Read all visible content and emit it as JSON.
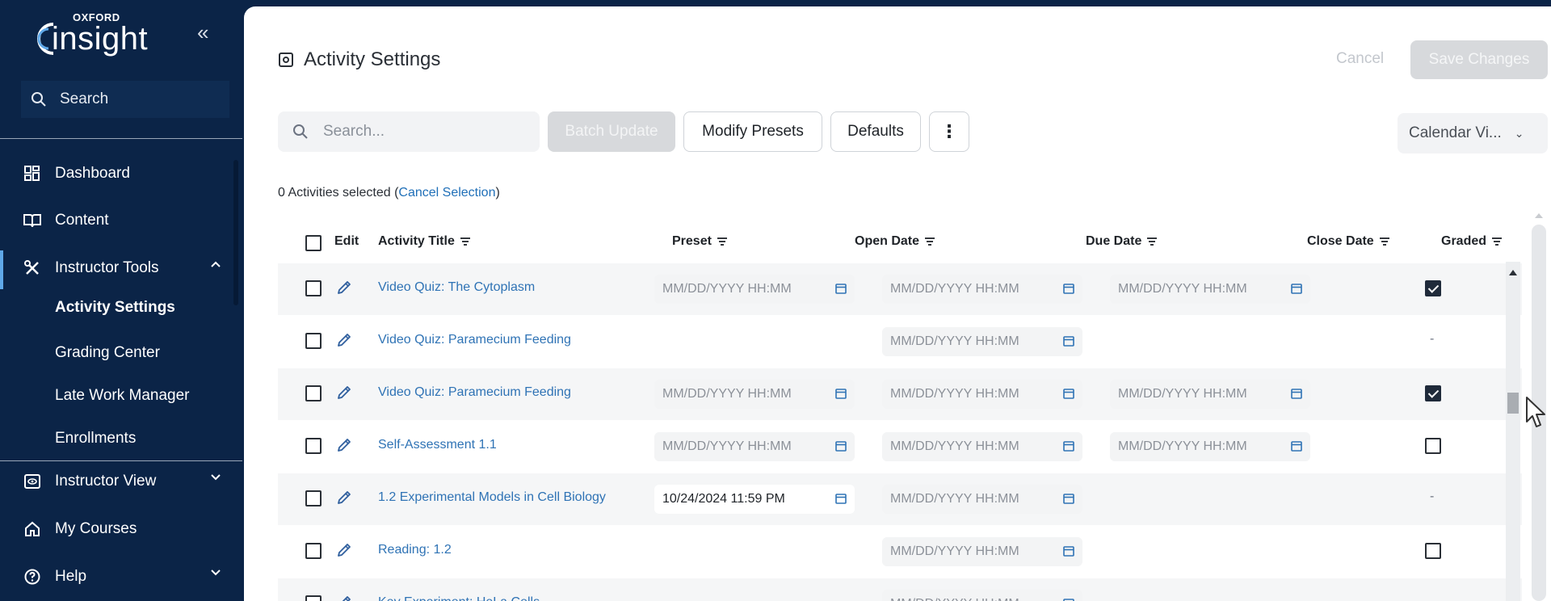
{
  "brand": {
    "top": "OXFORD",
    "name": "insight"
  },
  "sidebar": {
    "search_label": "Search",
    "items": [
      {
        "label": "Dashboard",
        "icon": "dashboard-icon"
      },
      {
        "label": "Content",
        "icon": "book-icon"
      },
      {
        "label": "Instructor Tools",
        "icon": "tools-icon",
        "expanded": true
      },
      {
        "label": "Instructor View",
        "icon": "eye-icon"
      },
      {
        "label": "My Courses",
        "icon": "home-icon"
      },
      {
        "label": "Help",
        "icon": "help-icon"
      }
    ],
    "sub_items": [
      {
        "label": "Activity Settings",
        "active": true
      },
      {
        "label": "Grading Center"
      },
      {
        "label": "Late Work Manager"
      },
      {
        "label": "Enrollments"
      }
    ]
  },
  "header": {
    "title": "Activity Settings",
    "cancel_label": "Cancel",
    "save_label": "Save Changes"
  },
  "toolbar": {
    "search_placeholder": "Search...",
    "batch_label": "Batch Update",
    "modify_label": "Modify Presets",
    "defaults_label": "Defaults",
    "more_label": "⋮",
    "calendar_label": "Calendar Vi..."
  },
  "selection": {
    "text": "0 Activities selected (",
    "link": "Cancel Selection",
    "close": ")"
  },
  "table": {
    "columns": {
      "edit": "Edit",
      "title": "Activity Title",
      "preset": "Preset",
      "open": "Open Date",
      "due": "Due Date",
      "close": "Close Date",
      "graded": "Graded"
    },
    "placeholder": "MM/DD/YYYY HH:MM",
    "rows": [
      {
        "title": "Video Quiz: The Cytoplasm",
        "open": "MM/DD/YYYY HH:MM",
        "due": "MM/DD/YYYY HH:MM",
        "close": "MM/DD/YYYY HH:MM",
        "graded": "checked"
      },
      {
        "title": "Video Quiz: Paramecium Feeding",
        "open": "",
        "due": "MM/DD/YYYY HH:MM",
        "close": "",
        "graded": "-"
      },
      {
        "title": "Video Quiz: Paramecium Feeding",
        "open": "MM/DD/YYYY HH:MM",
        "due": "MM/DD/YYYY HH:MM",
        "close": "MM/DD/YYYY HH:MM",
        "graded": "checked"
      },
      {
        "title": "Self-Assessment 1.1",
        "open": "MM/DD/YYYY HH:MM",
        "due": "MM/DD/YYYY HH:MM",
        "close": "MM/DD/YYYY HH:MM",
        "graded": "unchecked"
      },
      {
        "title": "1.2 Experimental Models in Cell Biology",
        "open": "10/24/2024 11:59 PM",
        "due": "MM/DD/YYYY HH:MM",
        "close": "",
        "graded": "-"
      },
      {
        "title": "Reading: 1.2",
        "open": "",
        "due": "MM/DD/YYYY HH:MM",
        "close": "",
        "graded": "unchecked"
      },
      {
        "title": "Key Experiment: HeLa Cells",
        "open": "",
        "due": "MM/DD/YYYY HH:MM",
        "close": "",
        "graded": "-"
      }
    ]
  }
}
